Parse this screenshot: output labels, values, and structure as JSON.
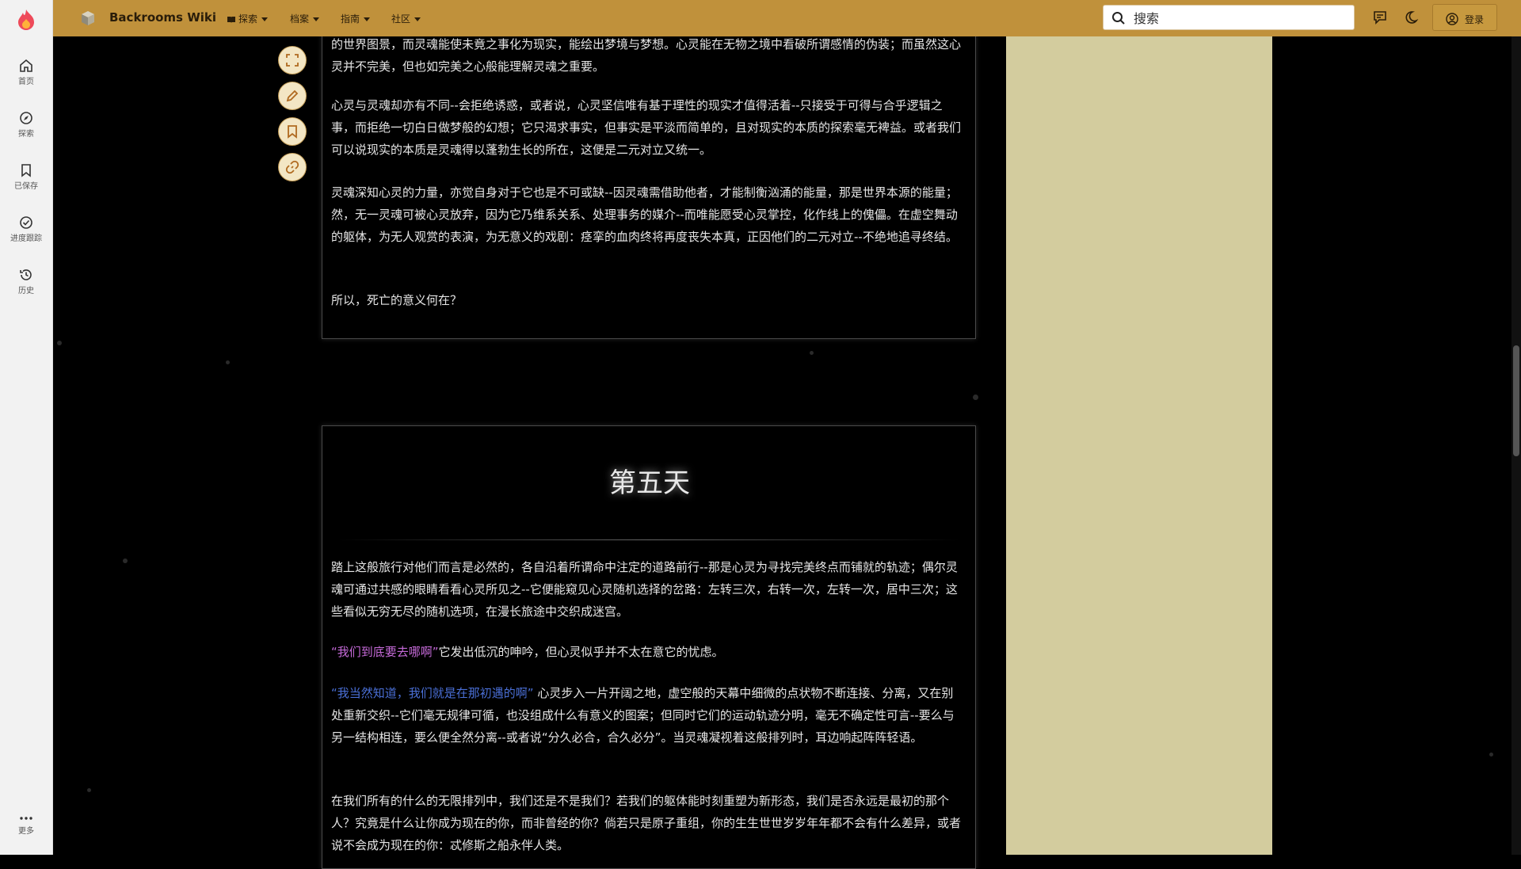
{
  "rail": {
    "items": [
      {
        "label": "首页",
        "icon": "home-icon"
      },
      {
        "label": "探索",
        "icon": "compass-icon"
      },
      {
        "label": "已保存",
        "icon": "bookmark-icon"
      },
      {
        "label": "进度跟踪",
        "icon": "check-circle-icon"
      },
      {
        "label": "历史",
        "icon": "history-icon"
      },
      {
        "label": "更多",
        "icon": "more-icon"
      }
    ]
  },
  "topbar": {
    "title": "Backrooms Wiki",
    "nav": [
      "探索",
      "档案",
      "指南",
      "社区"
    ],
    "search_placeholder": "搜索",
    "login_label": "登录"
  },
  "content": {
    "box1": {
      "p1": "的世界图景，而灵魂能使未竟之事化为现实，能绘出梦境与梦想。心灵能在无物之境中看破所谓感情的伪装；而虽然这心灵并不完美，但也如完美之心般能理解灵魂之重要。",
      "p2": "心灵与灵魂却亦有不同--会拒绝诱惑，或者说，心灵坚信唯有基于理性的现实才值得活着--只接受于可得与合乎逻辑之事，而拒绝一切白日做梦般的幻想；它只渴求事实，但事实是平淡而简单的，且对现实的本质的探索毫无裨益。或者我们可以说现实的本质是灵魂得以蓬勃生长的所在，这便是二元对立又统一。",
      "p3": "灵魂深知心灵的力量，亦觉自身对于它也是不可或缺--因灵魂需借助他者，才能制衡汹涌的能量，那是世界本源的能量；然，无一灵魂可被心灵放弃，因为它乃维系关系、处理事务的媒介--而唯能愿受心灵掌控，化作线上的傀儡。在虚空舞动的躯体，为无人观赏的表演，为无意义的戏剧：痉挛的血肉终将再度丧失本真，正因他们的二元对立--不绝地追寻终结。",
      "p4": "所以，死亡的意义何在？"
    },
    "box2": {
      "heading": "第五天",
      "p1": "踏上这般旅行对他们而言是必然的，各自沿着所谓命中注定的道路前行--那是心灵为寻找完美终点而铺就的轨迹；偶尔灵魂可通过共感的眼睛看看心灵所见之--它便能窥见心灵随机选择的岔路：左转三次，右转一次，左转一次，居中三次；这些看似无穷无尽的随机选项，在漫长旅途中交织成迷宫。",
      "p2_quote": "“我们到底要去哪啊”",
      "p2_rest": "它发出低沉的呻吟，但心灵似乎并不太在意它的忧虑。",
      "p3_quote": "“我当然知道，我们就是在那初遇的啊”",
      "p3_rest": " 心灵步入一片开阔之地，虚空般的天幕中细微的点状物不断连接、分离，又在别处重新交织--它们毫无规律可循，也没组成什么有意义的图案；但同时它们的运动轨迹分明，毫无不确定性可言--要么与另一结构相连，要么便全然分离--或者说“分久必合，合久必分”。当灵魂凝视着这般排列时，耳边响起阵阵轻语。",
      "p4": "在我们所有的什么的无限排列中，我们还是不是我们？若我们的躯体能时刻重塑为新形态，我们是否永远是最初的那个人？究竟是什么让你成为现在的你，而非曾经的你？倘若只是原子重组，你的生生世世岁岁年年都不会有什么差异，或者说不会成为现在的你：忒修斯之船永伴人类。"
    }
  },
  "colors": {
    "topbar": "#c0913b",
    "side_panel": "#d3cc9e",
    "pink_quote": "#c56ad8",
    "blue_quote": "#4a6fd6"
  }
}
